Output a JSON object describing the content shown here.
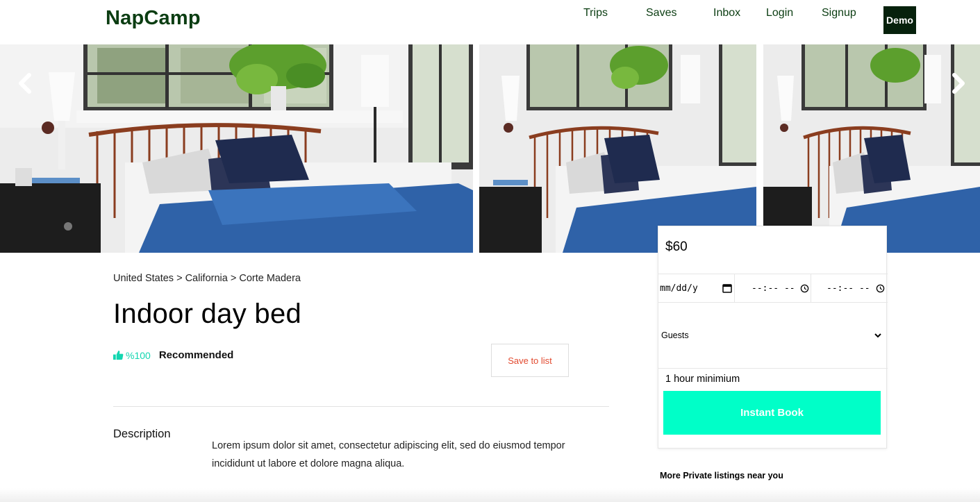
{
  "header": {
    "logo": "NapCamp",
    "nav": {
      "trips": "Trips",
      "saves": "Saves",
      "inbox": "Inbox",
      "login": "Login",
      "signup": "Signup"
    },
    "demo_label": "Demo"
  },
  "gallery": {
    "prev_icon": "chevron-left-icon",
    "next_icon": "chevron-right-icon"
  },
  "listing": {
    "breadcrumb": "United States > California > Corte Madera",
    "title": "Indoor day bed",
    "rating_percent": "%100",
    "rating_label": "Recommended",
    "save_label": "Save to list",
    "description_heading": "Description",
    "description": "Lorem ipsum dolor sit amet, consectetur adipiscing elit, sed do eiusmod tempor incididunt ut labore et dolore magna aliqua."
  },
  "booking": {
    "price": "$60",
    "date_placeholder": "mm/dd/y",
    "start_time_placeholder": "--:-- --",
    "end_time_placeholder": "--:-- --",
    "guests_label": "Guests",
    "minimum": "1 hour minimium",
    "book_label": "Instant Book"
  },
  "more_listings": "More Private listings near you",
  "colors": {
    "brand": "#0b3d12",
    "accent": "#00ffc8",
    "save_text": "#e24a2f",
    "rating": "#13d6b0"
  }
}
